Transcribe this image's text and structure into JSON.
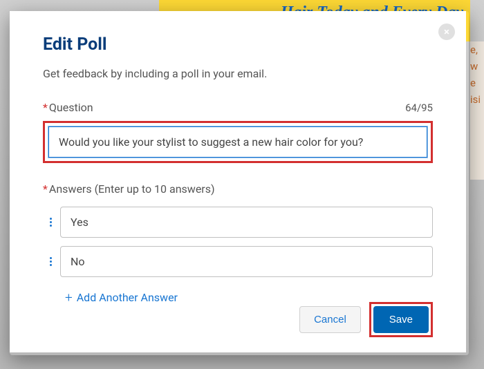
{
  "background": {
    "banner_text": "Hair Today and Every Day",
    "partial_text": "e,\nw\ne\nisi"
  },
  "modal": {
    "title": "Edit Poll",
    "subtitle": "Get feedback by including a poll in your email.",
    "close_label": "×"
  },
  "question": {
    "label": "Question",
    "char_count": "64/95",
    "value": "Would you like your stylist to suggest a new hair color for you?"
  },
  "answers": {
    "label": "Answers (Enter up to 10 answers)",
    "items": [
      {
        "value": "Yes"
      },
      {
        "value": "No"
      }
    ],
    "add_label": "Add Another Answer"
  },
  "buttons": {
    "cancel": "Cancel",
    "save": "Save"
  }
}
